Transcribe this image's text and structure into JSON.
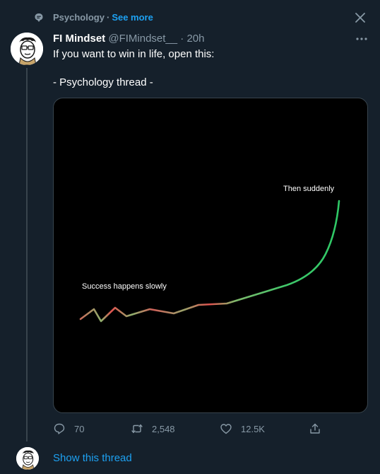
{
  "topic": {
    "label": "Psychology",
    "separator": "·",
    "see_more": "See more",
    "icon": "topic-bubble-icon"
  },
  "tweet": {
    "author_name": "FI Mindset",
    "handle": "@FIMindset__",
    "separator": "·",
    "time": "20h",
    "text_line1": "If you want to win in life, open this:",
    "text_line2": "- Psychology thread -",
    "media": {
      "annotation_top": "Then suddenly",
      "annotation_left": "Success happens slowly",
      "line_colors": {
        "low": "#e0524f",
        "mid": "#8fb06e",
        "high": "#2ec866"
      }
    },
    "actions": {
      "replies": "70",
      "retweets": "2,548",
      "likes": "12.5K"
    }
  },
  "show_thread": "Show this thread",
  "colors": {
    "background": "#15202b",
    "accent": "#1da1f2",
    "muted": "#8899a6"
  }
}
